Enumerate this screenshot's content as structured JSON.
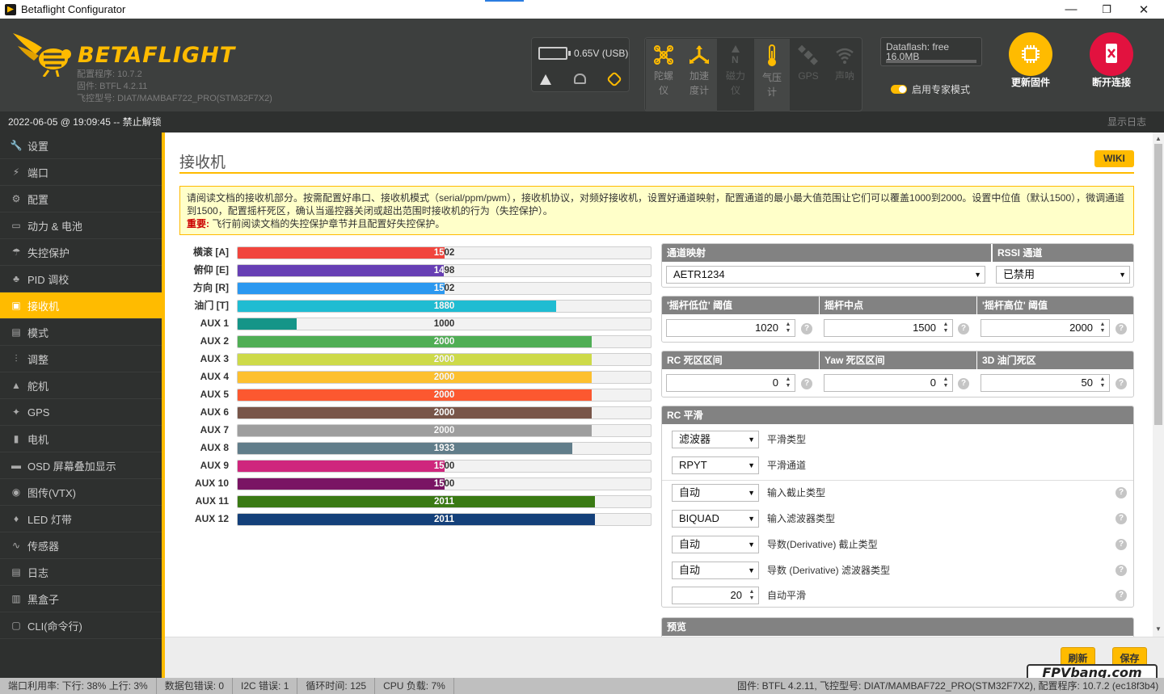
{
  "window": {
    "title": "Betaflight Configurator",
    "minimize": "—",
    "maximize": "❐",
    "close": "✕"
  },
  "header": {
    "logo": "BETAFLIGHT",
    "configurator_version": "配置程序: 10.7.2",
    "firmware": "固件: BTFL 4.2.11",
    "board": "飞控型号: DIAT/MAMBAF722_PRO(STM32F7X2)",
    "battery": "0.65V (USB)",
    "sensors": [
      {
        "name": "gyro",
        "label": "陀螺仪",
        "active": true
      },
      {
        "name": "accel",
        "label": "加速度计",
        "active": true
      },
      {
        "name": "mag",
        "label": "磁力仪",
        "active": false
      },
      {
        "name": "baro",
        "label": "气压计",
        "active": true
      },
      {
        "name": "gps",
        "label": "GPS",
        "active": false
      },
      {
        "name": "sonar",
        "label": "声呐",
        "active": false
      }
    ],
    "dataflash": "Dataflash: free 16.0MB",
    "expert_mode": "启用专家模式",
    "update_firmware": "更新固件",
    "disconnect": "断开连接"
  },
  "status": {
    "time": "2022-06-05 @ 19:09:45 -- 禁止解锁",
    "show_log": "显示日志"
  },
  "sidebar": {
    "items": [
      {
        "label": "设置",
        "icon": "wrench-icon",
        "glyph": "🔧"
      },
      {
        "label": "端口",
        "icon": "plug-icon",
        "glyph": "⚡"
      },
      {
        "label": "配置",
        "icon": "gear-icon",
        "glyph": "⚙"
      },
      {
        "label": "动力 & 电池",
        "icon": "battery-icon",
        "glyph": "▭"
      },
      {
        "label": "失控保护",
        "icon": "parachute-icon",
        "glyph": "☂"
      },
      {
        "label": "PID 调校",
        "icon": "sitemap-icon",
        "glyph": "♣"
      },
      {
        "label": "接收机",
        "icon": "receiver-icon",
        "glyph": "▣",
        "active": true
      },
      {
        "label": "模式",
        "icon": "modes-icon",
        "glyph": "▤"
      },
      {
        "label": "调整",
        "icon": "sliders-icon",
        "glyph": "⫶"
      },
      {
        "label": "舵机",
        "icon": "servo-icon",
        "glyph": "▲"
      },
      {
        "label": "GPS",
        "icon": "satellite-icon",
        "glyph": "✦"
      },
      {
        "label": "电机",
        "icon": "motor-icon",
        "glyph": "▮"
      },
      {
        "label": "OSD 屏幕叠加显示",
        "icon": "osd-icon",
        "glyph": "▬"
      },
      {
        "label": "图传(VTX)",
        "icon": "broadcast-icon",
        "glyph": "◉"
      },
      {
        "label": "LED 灯带",
        "icon": "led-icon",
        "glyph": "♦"
      },
      {
        "label": "传感器",
        "icon": "pulse-icon",
        "glyph": "∿"
      },
      {
        "label": "日志",
        "icon": "log-icon",
        "glyph": "▤"
      },
      {
        "label": "黑盒子",
        "icon": "blackbox-icon",
        "glyph": "▥"
      },
      {
        "label": "CLI(命令行)",
        "icon": "terminal-icon",
        "glyph": "▢"
      }
    ]
  },
  "page": {
    "title": "接收机",
    "wiki": "WIKI",
    "note": "请阅读文档的接收机部分。按需配置好串口、接收机模式（serial/ppm/pwm），接收机协议，对频好接收机，设置好通道映射，配置通道的最小最大值范围让它们可以覆盖1000到2000。设置中位值（默认1500），微调通道到1500，配置摇杆死区，确认当遥控器关闭或超出范围时接收机的行为（失控保护）。",
    "important_label": "重要:",
    "important_text": "飞行前阅读文档的失控保护章节并且配置好失控保护。"
  },
  "channels": [
    {
      "label": "横滚 [A]",
      "value": 1502,
      "color": "#f1453d"
    },
    {
      "label": "俯仰 [E]",
      "value": 1498,
      "color": "#673fb4"
    },
    {
      "label": "方向 [R]",
      "value": 1502,
      "color": "#2b98f0"
    },
    {
      "label": "油门 [T]",
      "value": 1880,
      "color": "#1fbcd2"
    },
    {
      "label": "AUX 1",
      "value": 1000,
      "color": "#159588"
    },
    {
      "label": "AUX 2",
      "value": 2000,
      "color": "#50ae55"
    },
    {
      "label": "AUX 3",
      "value": 2000,
      "color": "#cdda49"
    },
    {
      "label": "AUX 4",
      "value": 2000,
      "color": "#fdc02f"
    },
    {
      "label": "AUX 5",
      "value": 2000,
      "color": "#fc5830"
    },
    {
      "label": "AUX 6",
      "value": 2000,
      "color": "#785549"
    },
    {
      "label": "AUX 7",
      "value": 2000,
      "color": "#9e9e9e"
    },
    {
      "label": "AUX 8",
      "value": 1933,
      "color": "#617d8a"
    },
    {
      "label": "AUX 9",
      "value": 1500,
      "color": "#cf267d"
    },
    {
      "label": "AUX 10",
      "value": 1500,
      "color": "#7a1464"
    },
    {
      "label": "AUX 11",
      "value": 2011,
      "color": "#3a7a14"
    },
    {
      "label": "AUX 12",
      "value": 2011,
      "color": "#14407a"
    }
  ],
  "settings": {
    "channel_map_label": "通道映射",
    "channel_map_value": "AETR1234",
    "rssi_label": "RSSI 通道",
    "rssi_value": "已禁用",
    "stick_low_label": "'摇杆低位' 阈值",
    "stick_low_value": "1020",
    "stick_center_label": "摇杆中点",
    "stick_center_value": "1500",
    "stick_high_label": "'摇杆高位' 阈值",
    "stick_high_value": "2000",
    "rc_deadband_label": "RC 死区区间",
    "rc_deadband_value": "0",
    "yaw_deadband_label": "Yaw 死区区间",
    "yaw_deadband_value": "0",
    "throttle3d_label": "3D 油门死区",
    "throttle3d_value": "50",
    "rc_smoothing_label": "RC 平滑",
    "smoothing_type_value": "滤波器",
    "smoothing_type_label": "平滑类型",
    "smoothing_channels_value": "RPYT",
    "smoothing_channels_label": "平滑通道",
    "input_cutoff_value": "自动",
    "input_cutoff_label": "输入截止类型",
    "input_filter_value": "BIQUAD",
    "input_filter_label": "输入滤波器类型",
    "deriv_cutoff_value": "自动",
    "deriv_cutoff_label": "导数(Derivative) 截止类型",
    "deriv_filter_value": "自动",
    "deriv_filter_label": "导数 (Derivative) 滤波器类型",
    "auto_smooth_value": "20",
    "auto_smooth_label": "自动平滑",
    "preview_label": "预览"
  },
  "footer": {
    "refresh": "刷新",
    "save": "保存",
    "watermark": "FPVbang.com"
  },
  "bottom": {
    "port_util": "端口利用率:  下行: 38% 上行: 3%",
    "packet_err": "数据包错误: 0",
    "i2c_err": "I2C 错误: 1",
    "cycle": "循环时间: 125",
    "cpu": "CPU 负载: 7%",
    "right": "固件: BTFL 4.2.11, 飞控型号: DIAT/MAMBAF722_PRO(STM32F7X2), 配置程序: 10.7.2 (ec18f3b4)"
  }
}
